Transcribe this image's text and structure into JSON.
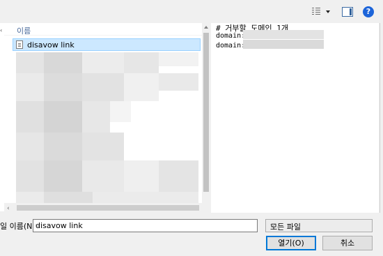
{
  "toolbar": {
    "view_icon": "details-view-icon",
    "preview_icon": "preview-pane-icon",
    "help_icon": "help-icon",
    "help_glyph": "?"
  },
  "file_list": {
    "column_header": "이름",
    "selected_file": "disavow link"
  },
  "preview": {
    "line1": "# 거부할 도메인 1개",
    "line2": "domain:",
    "line3": "domain:"
  },
  "form": {
    "filename_label": "일 이름(N):",
    "filename_value": "disavow link",
    "file_type_value": "모든 파일",
    "open_label": "열기(O)",
    "cancel_label": "취소"
  },
  "colors": {
    "selection_bg": "#cce8ff",
    "selection_border": "#99d1ff",
    "primary_button_border": "#0078d7",
    "help_blue": "#1c64d9"
  }
}
